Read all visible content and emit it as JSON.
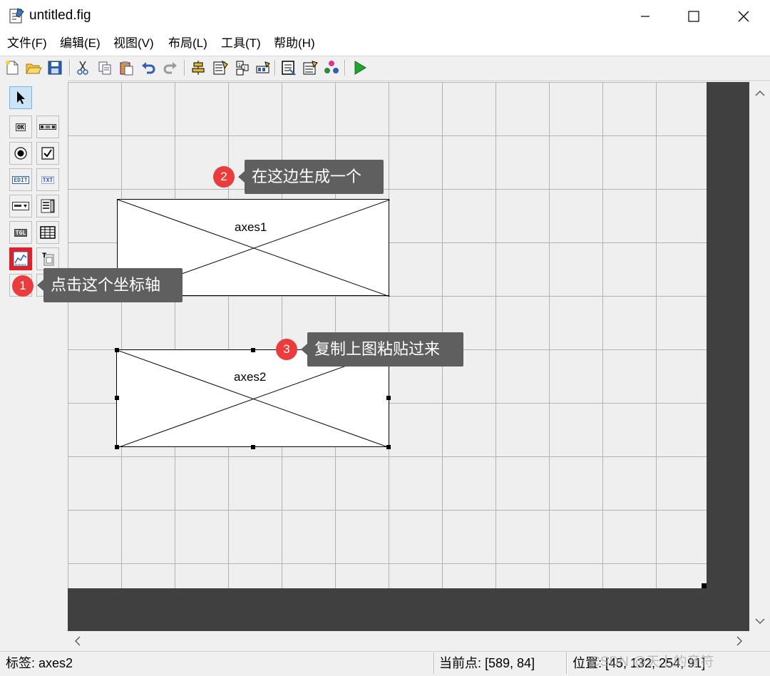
{
  "window": {
    "title": "untitled.fig",
    "controls": {
      "minimize": "minimize",
      "maximize": "maximize",
      "close": "close"
    }
  },
  "menu": [
    "文件(F)",
    "编辑(E)",
    "视图(V)",
    "布局(L)",
    "工具(T)",
    "帮助(H)"
  ],
  "palette": {
    "labels": {
      "ok": "OK",
      "edit": "EDIT",
      "txt": "TXT",
      "tgl": "TGL"
    }
  },
  "canvas": {
    "axes": [
      {
        "name": "axes1"
      },
      {
        "name": "axes2"
      }
    ]
  },
  "annotations": [
    {
      "number": "1",
      "text": "点击这个坐标轴"
    },
    {
      "number": "2",
      "text": "在这边生成一个"
    },
    {
      "number": "3",
      "text": "复制上图粘贴过来"
    }
  ],
  "status": {
    "tag": "标签: axes2",
    "current_point": "当前点:  [589, 84]",
    "position": "位置: [45, 132, 254, 91]"
  },
  "watermark": "CSDN @天上的音符",
  "colors": {
    "badge": "#ea3c3c",
    "tooltip": "#5f5f5f",
    "selected_tool": "#e81e25",
    "canvas_dark": "#404040"
  }
}
